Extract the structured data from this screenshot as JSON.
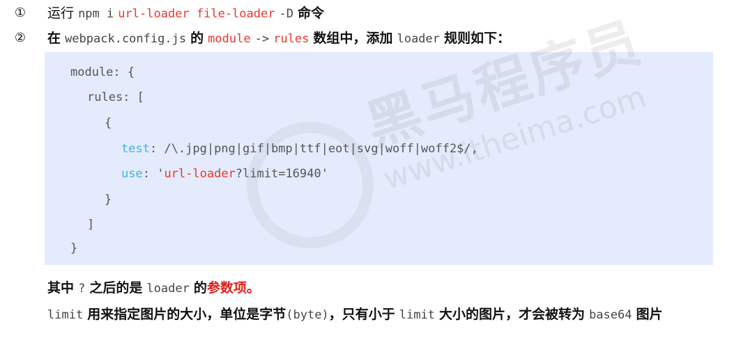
{
  "steps": [
    {
      "number": "①",
      "parts": [
        "运行",
        "npm i",
        "url-loader file-loader",
        "-D",
        "命令"
      ]
    },
    {
      "number": "②",
      "parts": [
        "在",
        "webpack.config.js",
        "的",
        "module",
        "->",
        "rules",
        "数组中，添加",
        "loader",
        "规则如下："
      ]
    }
  ],
  "code": {
    "l1": "module: {",
    "l2": "rules: [",
    "l3": "{",
    "l4_key": "test",
    "l4_rest": ": /\\.jpg|png|gif|bmp|ttf|eot|svg|woff|woff2$/,",
    "l5_key": "use",
    "l5_colon": ": '",
    "l5_value": "url-loader",
    "l5_rest": "?limit=16940'",
    "l6": "}",
    "l7": "]",
    "l8": "}"
  },
  "note1": {
    "a": "其中",
    "b": "?",
    "c": "之后的是",
    "d": "loader",
    "e": "的",
    "f": "参数项。"
  },
  "note2": {
    "a": "limit",
    "b": "用来指定图片的大小，单位是字节",
    "c": "(byte)",
    "d": "，只有小于",
    "e": "limit",
    "f": "大小的图片，才会被转为",
    "g": "base64",
    "h": "图片"
  },
  "watermark": {
    "big": "黑马程序员",
    "small": "www.itheima.com"
  },
  "colors": {
    "keyword_red": "#e8382f",
    "property_cyan": "#3fb7d9",
    "code_bg": "#e3ebfc",
    "highlight_red": "#e0201c"
  }
}
